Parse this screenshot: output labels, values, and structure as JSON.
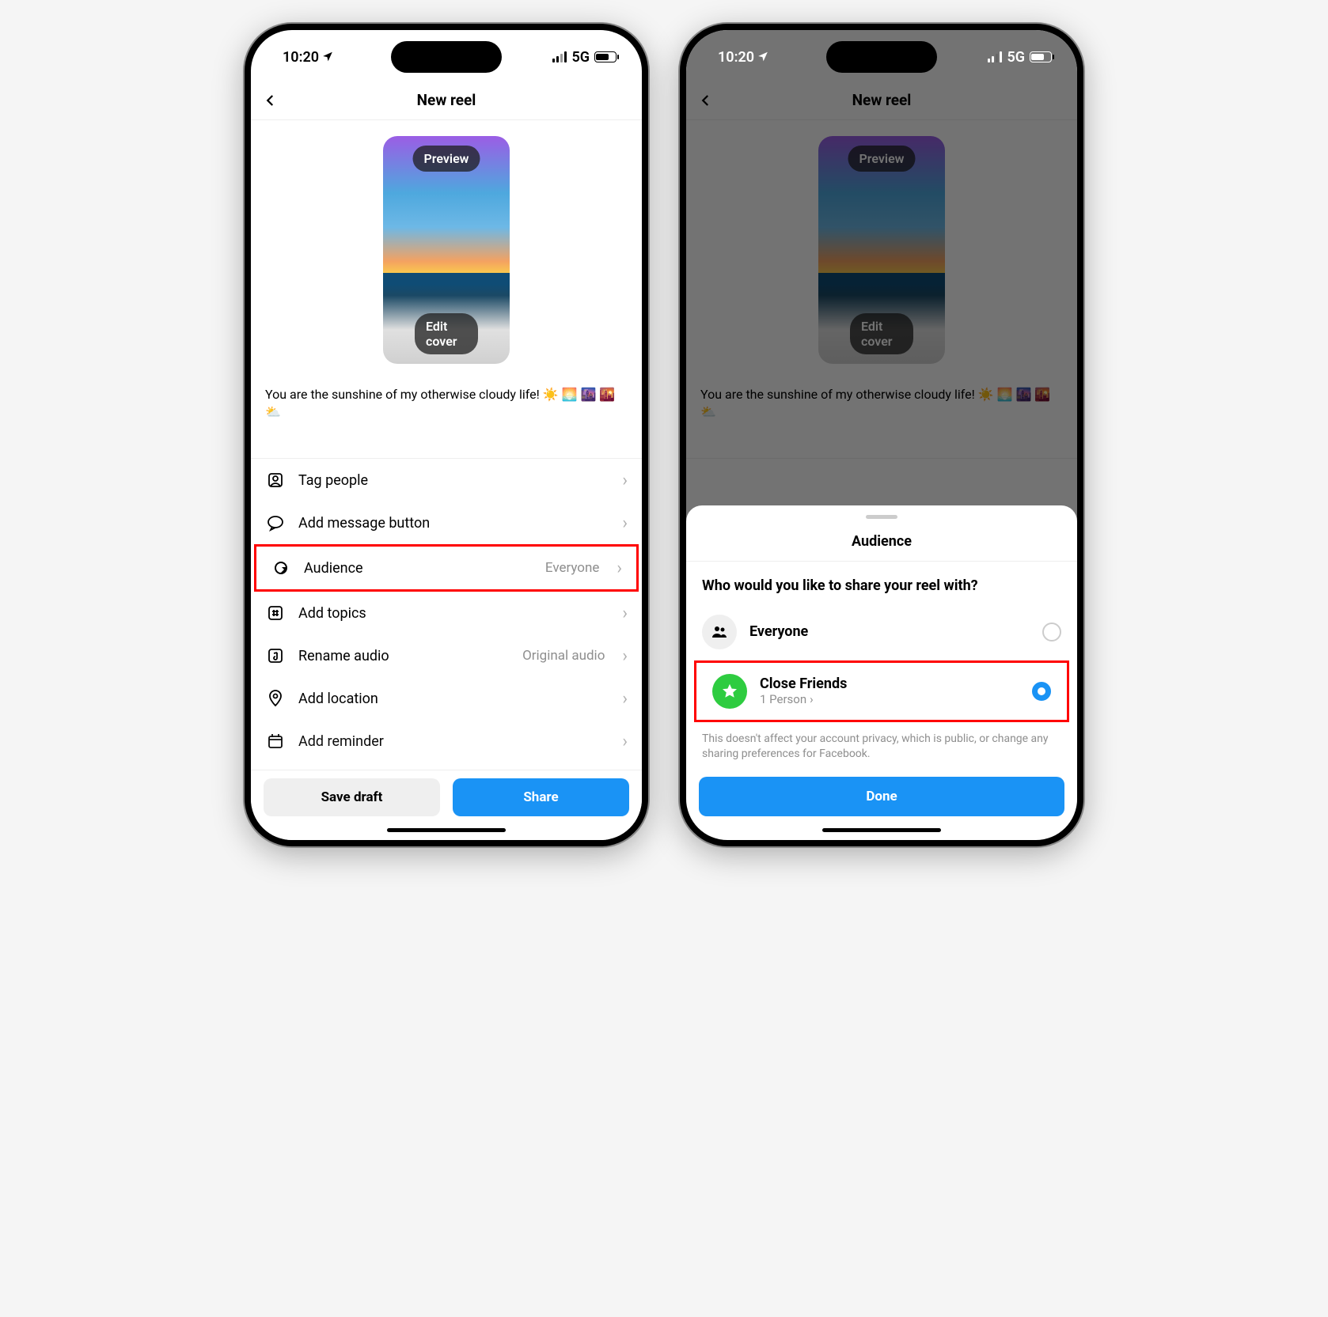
{
  "status": {
    "time": "10:20",
    "network": "5G"
  },
  "header": {
    "title": "New reel"
  },
  "cover": {
    "preview": "Preview",
    "edit": "Edit cover"
  },
  "caption": "You are the sunshine of my otherwise cloudy life! ☀️ 🌅 🌆 🌇 ⛅",
  "rows": {
    "tag_people": "Tag people",
    "add_message": "Add message button",
    "audience": {
      "label": "Audience",
      "value": "Everyone"
    },
    "add_topics": "Add topics",
    "rename_audio": {
      "label": "Rename audio",
      "value": "Original audio"
    },
    "add_location": "Add location",
    "add_reminder": "Add reminder"
  },
  "footer": {
    "draft": "Save draft",
    "share": "Share"
  },
  "sheet": {
    "title": "Audience",
    "question": "Who would you like to share your reel with?",
    "everyone": "Everyone",
    "close_friends": {
      "label": "Close Friends",
      "sub": "1 Person"
    },
    "note": "This doesn't affect your account privacy, which is public, or change any sharing preferences for Facebook.",
    "done": "Done"
  }
}
